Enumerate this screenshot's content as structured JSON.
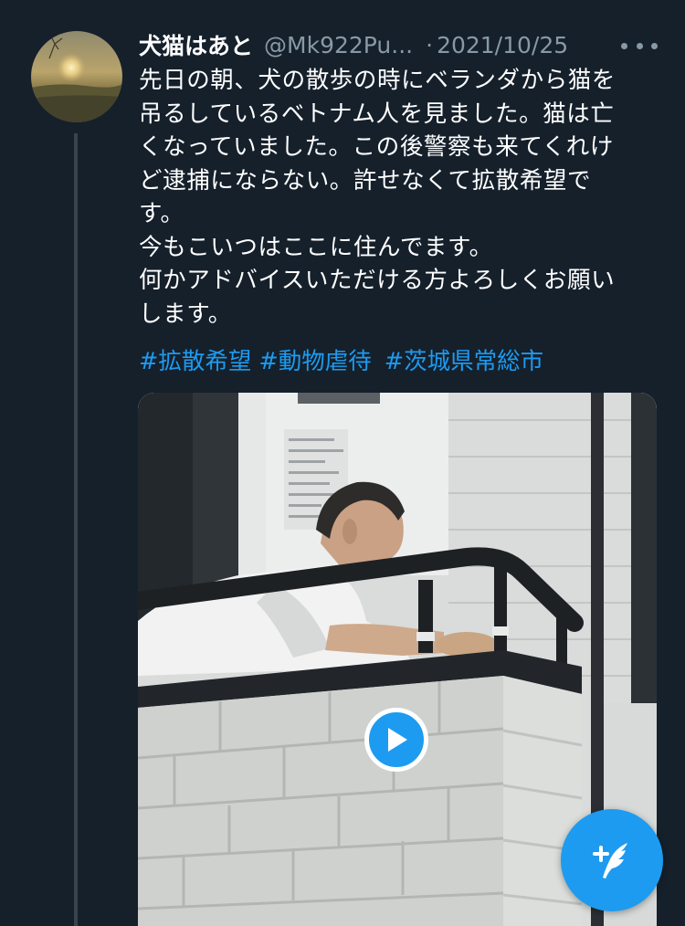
{
  "tweet": {
    "display_name": "犬猫はあと",
    "handle": "@Mk922Pu...",
    "separator": "·",
    "date": "2021/10/25",
    "body_lines": [
      "先日の朝、犬の散歩の時にベランダから猫を",
      "吊るしているベトナム人を見ました。猫は亡",
      "くなっていました。この後警察も来てくれけ",
      "ど逮捕にならない。許せなくて拡散希望で",
      "す。",
      "今もこいつはここに住んでます。",
      "何かアドバイスいただける方よろしくお願い",
      "します。"
    ],
    "hashtags": [
      "#拡散希望",
      "#動物虐待",
      "#茨城県常総市"
    ],
    "media_type": "video"
  },
  "icons": {
    "more": "more-dots-icon",
    "play": "play-icon",
    "compose": "compose-tweet-icon"
  },
  "colors": {
    "background": "#15202b",
    "accent": "#1d9bf0",
    "secondary_text": "#8899a6",
    "thread_line": "#38444d"
  }
}
